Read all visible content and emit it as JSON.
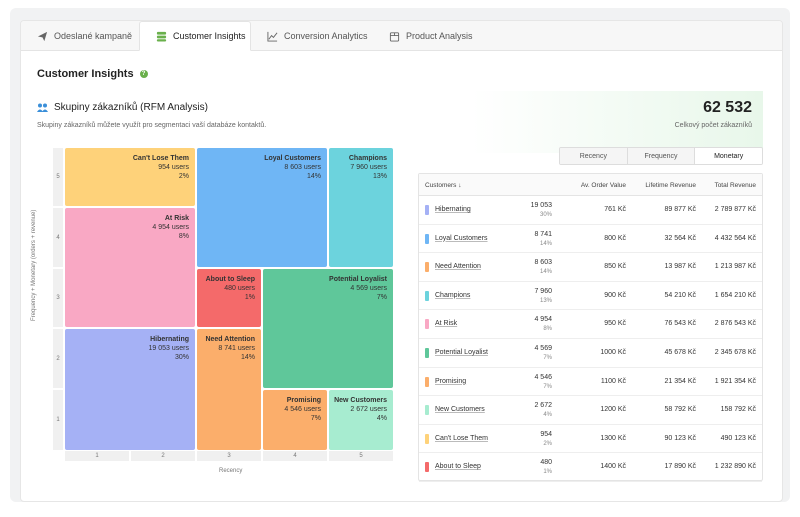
{
  "tabs": [
    {
      "label": "Odeslané kampaně",
      "icon": "paper-plane-icon",
      "active": false
    },
    {
      "label": "Customer Insights",
      "icon": "coins-icon",
      "active": true
    },
    {
      "label": "Conversion Analytics",
      "icon": "line-chart-icon",
      "active": false
    },
    {
      "label": "Product Analysis",
      "icon": "box-icon",
      "active": false
    }
  ],
  "page": {
    "title": "Customer Insights",
    "help": "?"
  },
  "section": {
    "title": "Skupiny zákazníků (RFM Analysis)",
    "description": "Skupiny zákazníků můžete využít pro segmentaci vaší databáze kontaktů.",
    "total_value": "62 532",
    "total_label": "Celkový počet zákazníků"
  },
  "colors": {
    "accent": "#6ab04c",
    "blue": "#6fb6f5",
    "cyan": "#6cd3dd",
    "yellow": "#fed27a",
    "pink": "#f9a8c4",
    "red": "#f46a6a",
    "orange": "#fbae6b",
    "green": "#5fc79a",
    "mint": "#a7ecd0",
    "purple": "#a5b1f5"
  },
  "segment_buttons": [
    "Recency",
    "Frequency",
    "Monetary"
  ],
  "heatmap": {
    "y_axis_label": "Frequency + Monetary (orders + revenue)",
    "x_axis_label": "Recency",
    "y_ticks": [
      "5",
      "4",
      "3",
      "2",
      "1"
    ],
    "x_ticks": [
      "1",
      "2",
      "3",
      "4",
      "5"
    ],
    "segments": [
      {
        "key": "cant_lose",
        "name": "Can't Lose Them",
        "users": "954 users",
        "pct": "2%"
      },
      {
        "key": "loyal",
        "name": "Loyal Customers",
        "users": "8 603 users",
        "pct": "14%"
      },
      {
        "key": "champions",
        "name": "Champions",
        "users": "7 960 users",
        "pct": "13%"
      },
      {
        "key": "at_risk",
        "name": "At Risk",
        "users": "4 954 users",
        "pct": "8%"
      },
      {
        "key": "about_sleep",
        "name": "About to Sleep",
        "users": "480 users",
        "pct": "1%"
      },
      {
        "key": "potential",
        "name": "Potential Loyalist",
        "users": "4 569 users",
        "pct": "7%"
      },
      {
        "key": "hibernating",
        "name": "Hibernating",
        "users": "19 053 users",
        "pct": "30%"
      },
      {
        "key": "need_attention",
        "name": "Need Attention",
        "users": "8 741 users",
        "pct": "14%"
      },
      {
        "key": "promising",
        "name": "Promising",
        "users": "4 546 users",
        "pct": "7%"
      },
      {
        "key": "new_customers",
        "name": "New Customers",
        "users": "2 672 users",
        "pct": "4%"
      }
    ]
  },
  "table": {
    "headers": {
      "customers": "Customers",
      "sort_icon": "arrow-down-icon",
      "aov": "Av. Order Value",
      "lifetime": "Lifetime Revenue",
      "total": "Total Revenue"
    },
    "rows": [
      {
        "name": "Hibernating",
        "color": "#a5b1f5",
        "count": "19 053",
        "pct": "30%",
        "aov": "761 Kč",
        "lifetime": "89 877 Kč",
        "total": "2 789 877 Kč"
      },
      {
        "name": "Loyal Customers",
        "color": "#6fb6f5",
        "count": "8 741",
        "pct": "14%",
        "aov": "800 Kč",
        "lifetime": "32 564 Kč",
        "total": "4 432 564 Kč"
      },
      {
        "name": "Need Attention",
        "color": "#fbae6b",
        "count": "8 603",
        "pct": "14%",
        "aov": "850 Kč",
        "lifetime": "13 987 Kč",
        "total": "1 213 987 Kč"
      },
      {
        "name": "Champions",
        "color": "#6cd3dd",
        "count": "7 960",
        "pct": "13%",
        "aov": "900 Kč",
        "lifetime": "54 210 Kč",
        "total": "1 654 210 Kč"
      },
      {
        "name": "At Risk",
        "color": "#f9a8c4",
        "count": "4 954",
        "pct": "8%",
        "aov": "950 Kč",
        "lifetime": "76 543 Kč",
        "total": "2 876 543 Kč"
      },
      {
        "name": "Potential Loyalist",
        "color": "#5fc79a",
        "count": "4 569",
        "pct": "7%",
        "aov": "1000 Kč",
        "lifetime": "45 678 Kč",
        "total": "2 345 678 Kč"
      },
      {
        "name": "Promising",
        "color": "#fbae6b",
        "count": "4 546",
        "pct": "7%",
        "aov": "1100 Kč",
        "lifetime": "21 354 Kč",
        "total": "1 921 354 Kč"
      },
      {
        "name": "New Customers",
        "color": "#a7ecd0",
        "count": "2 672",
        "pct": "4%",
        "aov": "1200 Kč",
        "lifetime": "58 792 Kč",
        "total": "158 792 Kč"
      },
      {
        "name": "Can't Lose Them",
        "color": "#fed27a",
        "count": "954",
        "pct": "2%",
        "aov": "1300 Kč",
        "lifetime": "90 123 Kč",
        "total": "490 123 Kč"
      },
      {
        "name": "About to Sleep",
        "color": "#f46a6a",
        "count": "480",
        "pct": "1%",
        "aov": "1400 Kč",
        "lifetime": "17 890 Kč",
        "total": "1 232 890 Kč"
      }
    ]
  }
}
